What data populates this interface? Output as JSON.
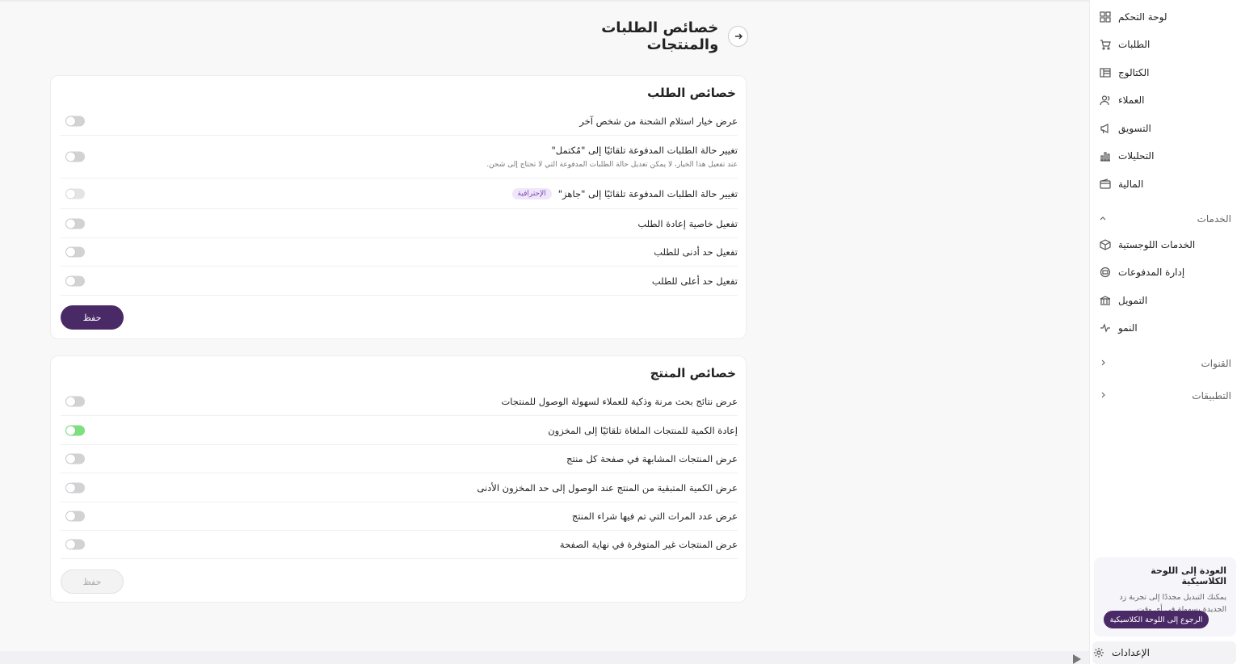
{
  "page_title": "خصائص الطلبات والمنتجات",
  "sidebar": {
    "items": [
      {
        "label": "لوحة التحكم",
        "icon": "dashboard-icon"
      },
      {
        "label": "الطلبات",
        "icon": "cart-icon"
      },
      {
        "label": "الكتالوج",
        "icon": "catalog-icon"
      },
      {
        "label": "العملاء",
        "icon": "users-icon"
      },
      {
        "label": "التسويق",
        "icon": "megaphone-icon"
      },
      {
        "label": "التحليلات",
        "icon": "bar-chart-icon"
      },
      {
        "label": "المالية",
        "icon": "wallet-icon"
      }
    ],
    "services_section": "الخدمات",
    "services": [
      {
        "label": "الخدمات اللوجستية",
        "icon": "box-icon"
      },
      {
        "label": "إدارة المدفوعات",
        "icon": "payment-icon"
      },
      {
        "label": "التمويل",
        "icon": "bank-icon"
      },
      {
        "label": "النمو",
        "icon": "pulse-icon"
      }
    ],
    "channels_section": "القنوات",
    "apps_section": "التطبيقات",
    "classic": {
      "title": "العودة إلى اللوحة الكلاسيكية",
      "desc": "يمكنك التبديل مجددًا إلى تجربة زد الجديدة بسهولة في أي وقت.",
      "button": "الرجوع إلى اللوحة الكلاسيكية"
    },
    "settings": {
      "label": "الإعدادات",
      "icon": "gear-icon"
    }
  },
  "order_card": {
    "title": "خصائص الطلب",
    "rows": [
      {
        "label": "عرض خيار استلام الشحنة من شخص آخر",
        "state": "off"
      },
      {
        "label": "تغيير حالة الطلبات المدفوعة تلقائيًا إلى \"مُكتمل\"",
        "sub": "عند تفعيل هذا الخيار، لا يمكن تعديل حالة الطلبات المدفوعة التي لا تحتاج إلى شحن.",
        "state": "off"
      },
      {
        "label": "تغيير حالة الطلبات المدفوعة تلقائيًا إلى \"جاهز\"",
        "badge": "الإحترافية",
        "state": "disabled"
      },
      {
        "label": "تفعيل خاصية إعادة الطلب",
        "state": "off"
      },
      {
        "label": "تفعيل حد أدنى للطلب",
        "state": "off"
      },
      {
        "label": "تفعيل حد أعلى للطلب",
        "state": "off"
      }
    ],
    "save_label": "حفظ"
  },
  "product_card": {
    "title": "خصائص المنتج",
    "rows": [
      {
        "label": "عرض نتائج بحث مرنة وذكية للعملاء لسهولة الوصول للمنتجات",
        "state": "off"
      },
      {
        "label": "إعادة الكمية للمنتجات الملغاة تلقائيًا إلى المخزون",
        "state": "on"
      },
      {
        "label": "عرض المنتجات المشابهة في صفحة كل منتج",
        "state": "off"
      },
      {
        "label": "عرض الكمية المتبقية من المنتج عند الوصول إلى حد المخزون الأدنى",
        "state": "off"
      },
      {
        "label": "عرض عدد المرات التي تم فيها شراء المنتج",
        "state": "off"
      },
      {
        "label": "عرض المنتجات غير المتوفرة في نهاية الصفحة",
        "state": "off"
      }
    ],
    "save_label": "حفظ"
  },
  "colors": {
    "primary": "#4a2a66",
    "toggle_on": "#7ddf7f",
    "badge_bg": "#efe6fa",
    "badge_text": "#7a4bb8"
  }
}
